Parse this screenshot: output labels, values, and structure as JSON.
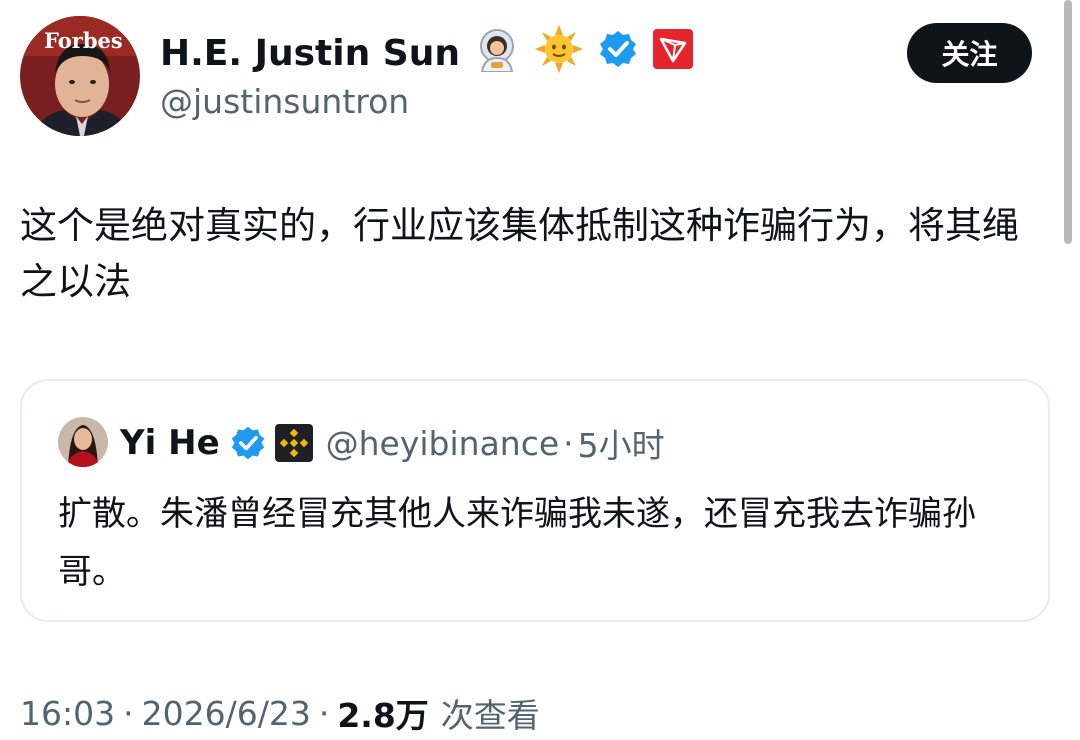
{
  "author": {
    "display_name": "H.E. Justin Sun",
    "handle": "@justinsuntron",
    "avatar_text": "Forbes",
    "emojis": [
      "astronaut-emoji",
      "sun-emoji"
    ],
    "verified": true,
    "badge": "tron-logo"
  },
  "follow_button": {
    "label": "关注"
  },
  "tweet": {
    "text": "这个是绝对真实的，行业应该集体抵制这种诈骗行为，将其绳之以法"
  },
  "quote": {
    "author_name": "Yi He",
    "handle": "@heyibinance",
    "separator": "·",
    "time": "5小时",
    "text": "扩散。朱潘曾经冒充其他人来诈骗我未遂，还冒充我去诈骗孙哥。",
    "verified": true,
    "badge": "binance-logo"
  },
  "meta": {
    "time": "16:03",
    "separator": "·",
    "date": "2026/6/23",
    "views_count": "2.8万",
    "views_label": "次查看"
  },
  "colors": {
    "primary_text": "#0f1419",
    "secondary_text": "#536471",
    "verified_blue": "#1d9bf0",
    "tron_red": "#e5252b",
    "binance_yellow": "#f0b90b",
    "border": "#e7ecf0",
    "button_bg": "#0f1419"
  }
}
